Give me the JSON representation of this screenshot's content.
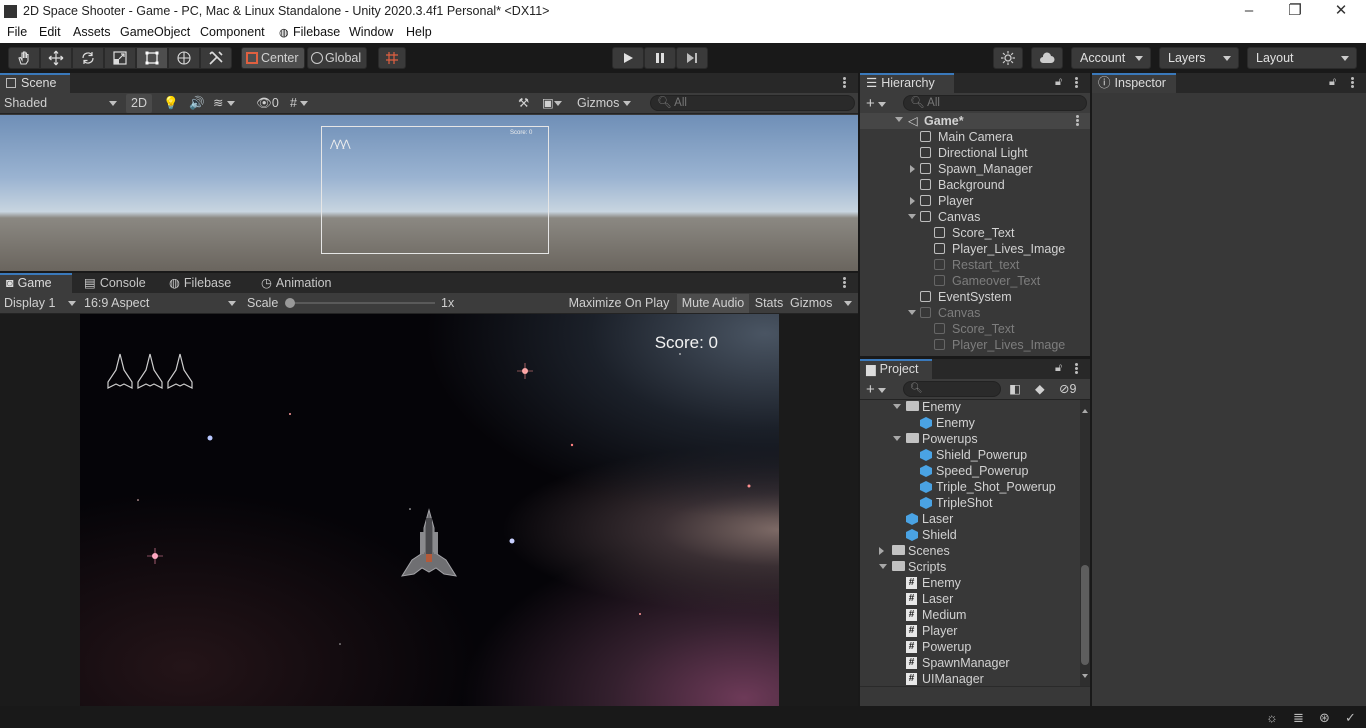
{
  "window": {
    "title": "2D Space Shooter - Game - PC, Mac & Linux Standalone - Unity 2020.3.4f1 Personal* <DX11>",
    "controls": [
      "–",
      "❐",
      "✕"
    ]
  },
  "menu": [
    "File",
    "Edit",
    "Assets",
    "GameObject",
    "Component",
    "Filebase",
    "Window",
    "Help"
  ],
  "toolbar": {
    "pivot": "Center",
    "space": "Global",
    "account": "Account",
    "layers": "Layers",
    "layout": "Layout"
  },
  "scene": {
    "tab": "Scene",
    "draw_mode": "Shaded",
    "mode_2d": "2D",
    "hidden_count": "0",
    "gizmos": "Gizmos",
    "search_placeholder": "All",
    "preview_score": "Score: 0"
  },
  "bottom_tabs": [
    "Game",
    "Console",
    "Filebase",
    "Animation"
  ],
  "game": {
    "display": "Display 1",
    "aspect": "16:9 Aspect",
    "scale_label": "Scale",
    "scale_value": "1x",
    "maximize": "Maximize On Play",
    "mute": "Mute Audio",
    "stats": "Stats",
    "gizmos": "Gizmos",
    "score": "Score: 0",
    "lives": 3
  },
  "hierarchy": {
    "tab": "Hierarchy",
    "search_placeholder": "All",
    "scene_name": "Game*",
    "items": [
      {
        "label": "Main Camera",
        "depth": 1,
        "dim": false,
        "expand": ""
      },
      {
        "label": "Directional Light",
        "depth": 1,
        "dim": false,
        "expand": ""
      },
      {
        "label": "Spawn_Manager",
        "depth": 1,
        "dim": false,
        "expand": "right"
      },
      {
        "label": "Background",
        "depth": 1,
        "dim": false,
        "expand": ""
      },
      {
        "label": "Player",
        "depth": 1,
        "dim": false,
        "expand": "right"
      },
      {
        "label": "Canvas",
        "depth": 1,
        "dim": false,
        "expand": "down"
      },
      {
        "label": "Score_Text",
        "depth": 2,
        "dim": false,
        "expand": ""
      },
      {
        "label": "Player_Lives_Image",
        "depth": 2,
        "dim": false,
        "expand": ""
      },
      {
        "label": "Restart_text",
        "depth": 2,
        "dim": true,
        "expand": ""
      },
      {
        "label": "Gameover_Text",
        "depth": 2,
        "dim": true,
        "expand": ""
      },
      {
        "label": "EventSystem",
        "depth": 1,
        "dim": false,
        "expand": ""
      },
      {
        "label": "Canvas",
        "depth": 1,
        "dim": true,
        "expand": "down"
      },
      {
        "label": "Score_Text",
        "depth": 2,
        "dim": true,
        "expand": ""
      },
      {
        "label": "Player_Lives_Image",
        "depth": 2,
        "dim": true,
        "expand": ""
      }
    ]
  },
  "inspector": {
    "tab": "Inspector"
  },
  "project": {
    "tab": "Project",
    "hidden_count": "9",
    "items": [
      {
        "label": "Enemy",
        "kind": "folder",
        "depth": 0,
        "expand": "down"
      },
      {
        "label": "Enemy",
        "kind": "prefab",
        "depth": 1,
        "expand": ""
      },
      {
        "label": "Powerups",
        "kind": "folder",
        "depth": 0,
        "expand": "down"
      },
      {
        "label": "Shield_Powerup",
        "kind": "prefab",
        "depth": 1,
        "expand": ""
      },
      {
        "label": "Speed_Powerup",
        "kind": "prefab",
        "depth": 1,
        "expand": ""
      },
      {
        "label": "Triple_Shot_Powerup",
        "kind": "prefab",
        "depth": 1,
        "expand": ""
      },
      {
        "label": "TripleShot",
        "kind": "prefab",
        "depth": 1,
        "expand": ""
      },
      {
        "label": "Laser",
        "kind": "prefab",
        "depth": 0,
        "expand": ""
      },
      {
        "label": "Shield",
        "kind": "prefab",
        "depth": 0,
        "expand": ""
      },
      {
        "label": "Scenes",
        "kind": "folder",
        "depth": -1,
        "expand": "right"
      },
      {
        "label": "Scripts",
        "kind": "folder",
        "depth": -1,
        "expand": "down"
      },
      {
        "label": "Enemy",
        "kind": "script",
        "depth": 0,
        "expand": ""
      },
      {
        "label": "Laser",
        "kind": "script",
        "depth": 0,
        "expand": ""
      },
      {
        "label": "Medium",
        "kind": "script",
        "depth": 0,
        "expand": ""
      },
      {
        "label": "Player",
        "kind": "script",
        "depth": 0,
        "expand": ""
      },
      {
        "label": "Powerup",
        "kind": "script",
        "depth": 0,
        "expand": ""
      },
      {
        "label": "SpawnManager",
        "kind": "script",
        "depth": 0,
        "expand": ""
      },
      {
        "label": "UIManager",
        "kind": "script",
        "depth": 0,
        "expand": ""
      }
    ]
  },
  "colors": {
    "accent": "#3a79bb",
    "prefab": "#4aa3e4",
    "panel": "#383838"
  }
}
